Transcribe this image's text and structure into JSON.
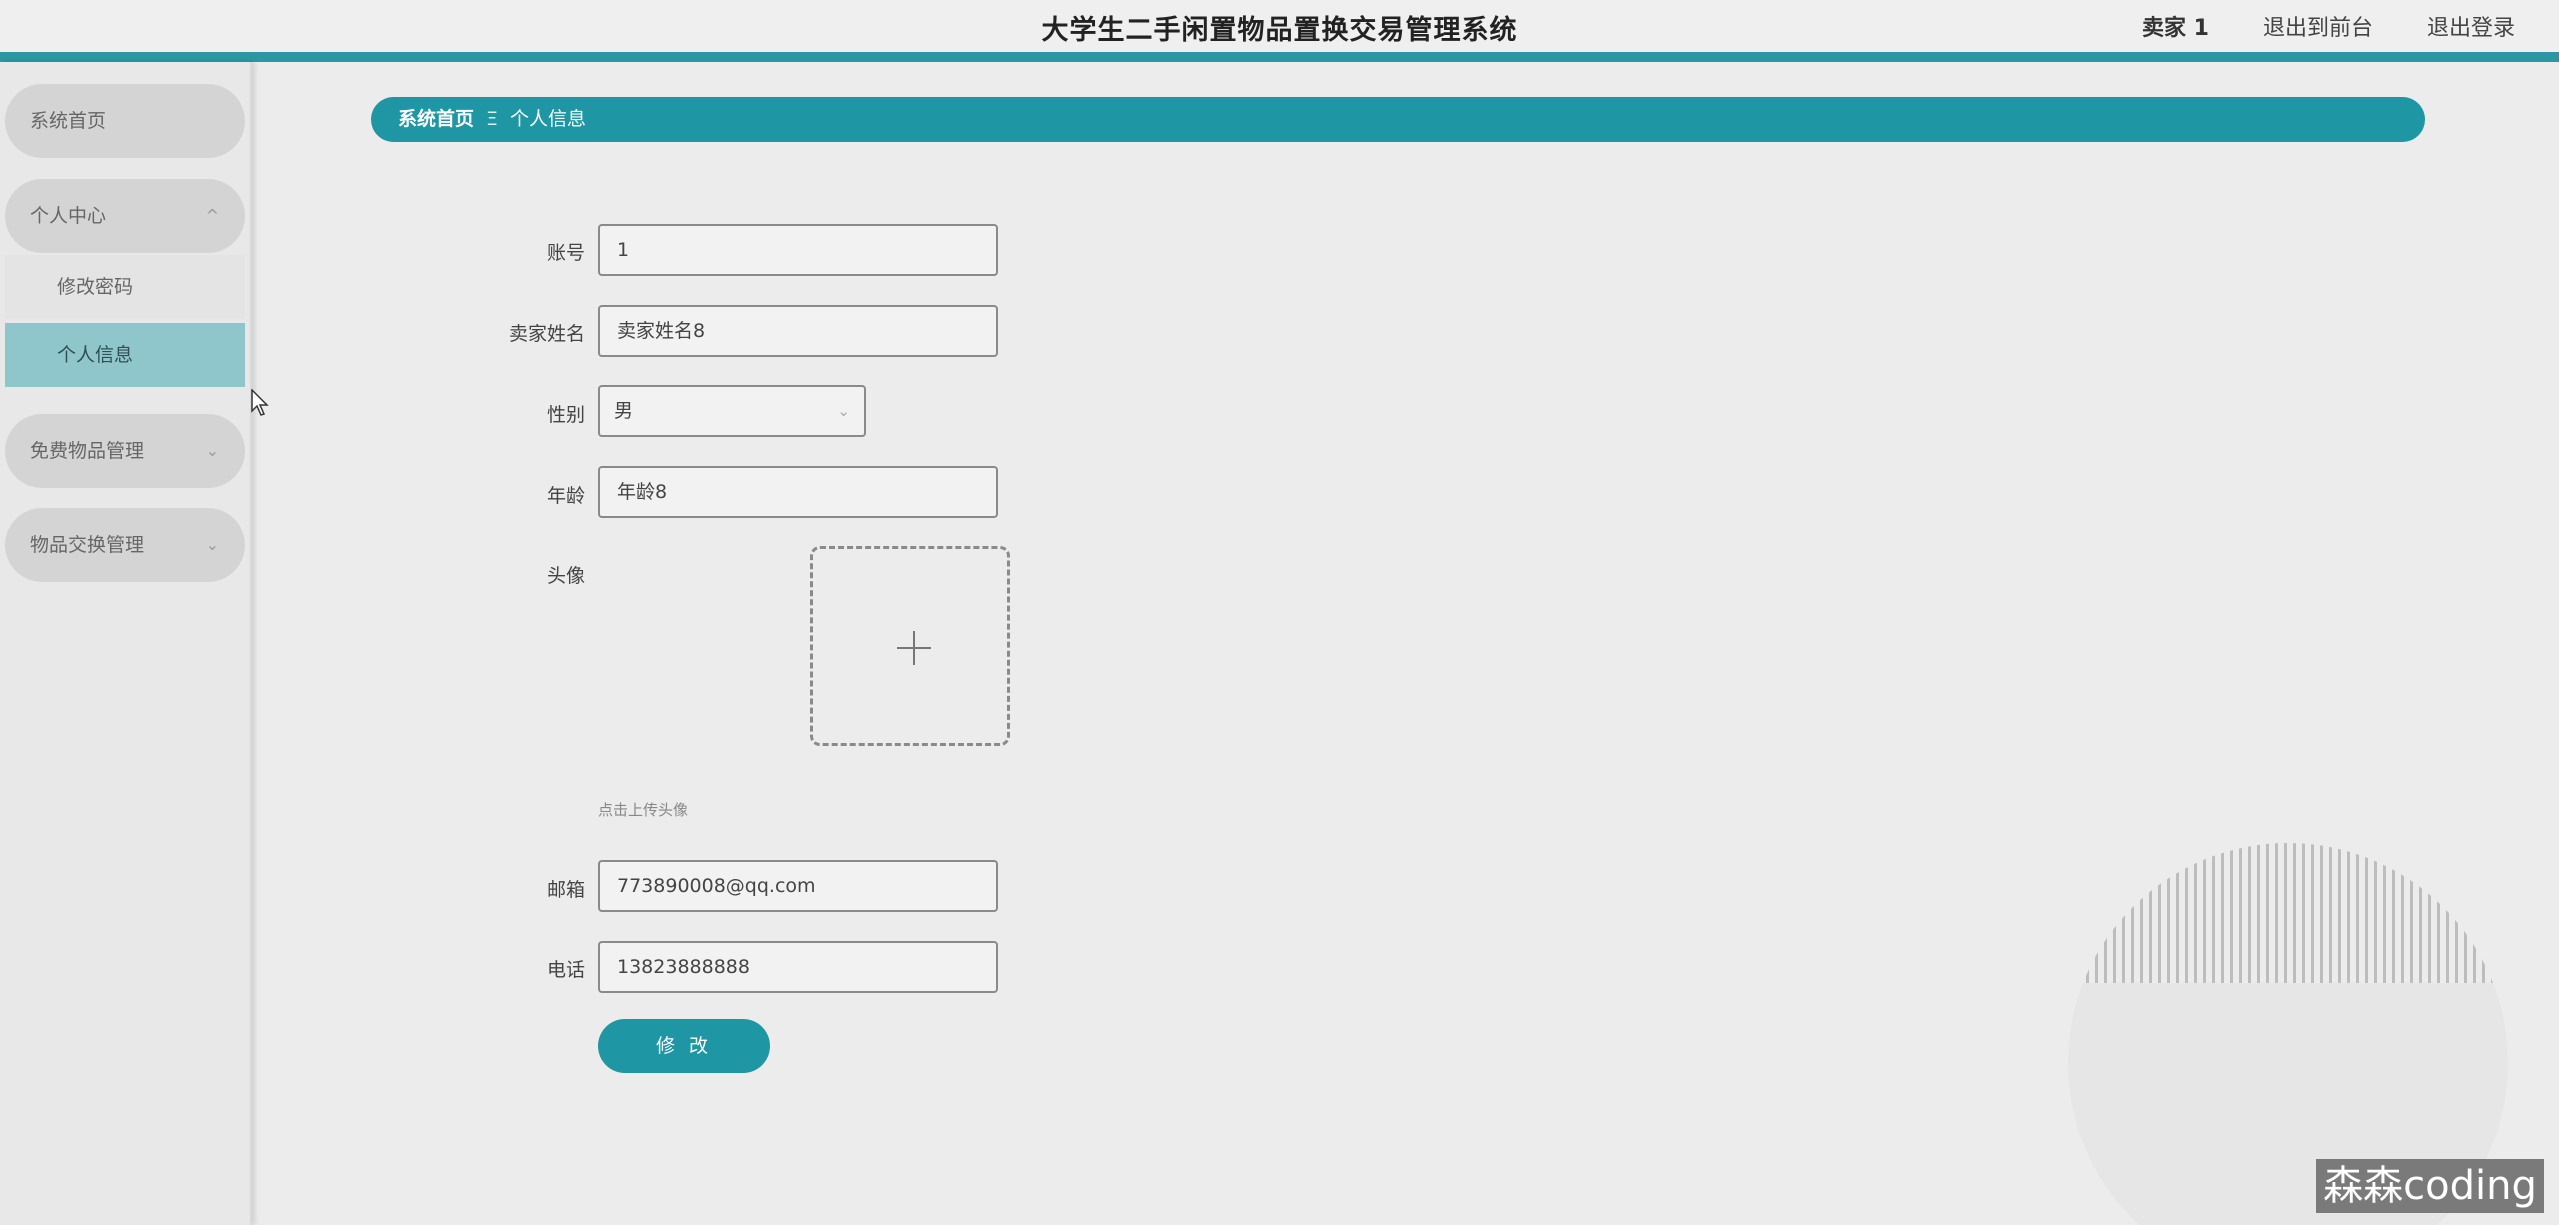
{
  "header": {
    "title": "大学生二手闲置物品置换交易管理系统",
    "user": "卖家 1",
    "back_to_front": "退出到前台",
    "logout": "退出登录"
  },
  "sidebar": {
    "items": [
      {
        "label": "系统首页"
      },
      {
        "label": "个人中心",
        "expanded": true
      },
      {
        "label": "免费物品管理"
      },
      {
        "label": "物品交换管理"
      }
    ],
    "subitems": [
      {
        "label": "修改密码"
      },
      {
        "label": "个人信息",
        "active": true
      }
    ]
  },
  "breadcrumb": {
    "home": "系统首页",
    "separator": "Ξ",
    "current": "个人信息"
  },
  "form": {
    "account": {
      "label": "账号",
      "value": "1"
    },
    "seller_name": {
      "label": "卖家姓名",
      "value": "卖家姓名8"
    },
    "gender": {
      "label": "性别",
      "value": "男"
    },
    "age": {
      "label": "年龄",
      "value": "年龄8"
    },
    "avatar": {
      "label": "头像",
      "hint": "点击上传头像"
    },
    "email": {
      "label": "邮箱",
      "value": "773890008@qq.com"
    },
    "phone": {
      "label": "电话",
      "value": "13823888888"
    },
    "submit_label": "修 改"
  },
  "watermark": "森森coding",
  "colors": {
    "accent": "#1f96a3",
    "active_menu": "#8fc6cc",
    "background": "#ececec"
  }
}
